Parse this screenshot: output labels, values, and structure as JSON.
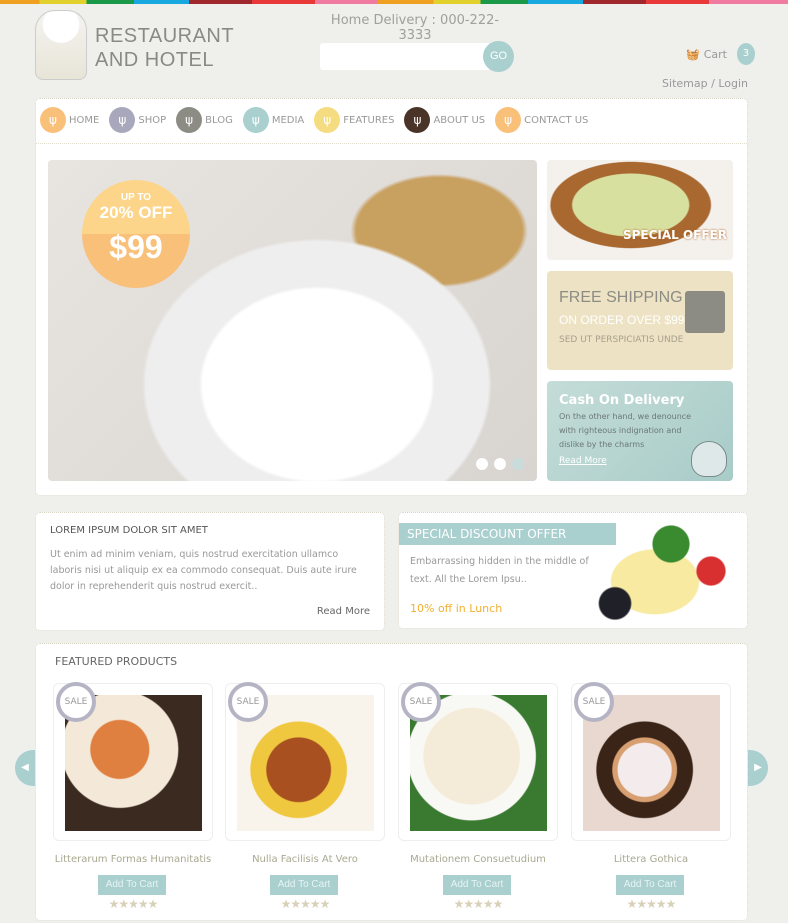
{
  "header": {
    "logo_line1": "RESTAURANT",
    "logo_line2": "AND HOTEL",
    "delivery": "Home Delivery : 000-222-3333",
    "search_placeholder": "",
    "go_label": "GO",
    "cart_label": "Cart",
    "cart_count": "3",
    "sitemap": "Sitemap",
    "login": "Login",
    "sep": " / "
  },
  "nav": [
    {
      "label": "HOME",
      "color": "#f9c07a"
    },
    {
      "label": "SHOP",
      "color": "#a8a8bc"
    },
    {
      "label": "BLOG",
      "color": "#8c8c84"
    },
    {
      "label": "MEDIA",
      "color": "#a9cfcf"
    },
    {
      "label": "FEATURES",
      "color": "#f5dc80"
    },
    {
      "label": "ABOUT US",
      "color": "#4a3428"
    },
    {
      "label": "CONTACT US",
      "color": "#f9c07a"
    }
  ],
  "slider": {
    "upto": "UP TO",
    "percent": "20% OFF",
    "price": "$99"
  },
  "side": {
    "special": "SPECIAL OFFER",
    "ship_title": "FREE SHIPPING",
    "ship_sub": "ON ORDER OVER $99",
    "ship_note": "SED UT PERSPICIATIS UNDE",
    "cod_title": "Cash On Delivery",
    "cod_text": "On the other hand, we denounce with righteous indignation and dislike by the charms",
    "cod_link": "Read More"
  },
  "lorem": {
    "title": "LOREM IPSUM DOLOR SIT AMET",
    "text": "Ut enim ad minim veniam, quis nostrud exercitation ullamco laboris nisi ut aliquip ex ea commodo consequat. Duis aute irure dolor in reprehenderit quis nostrud exercit..",
    "link": "Read More"
  },
  "discount": {
    "title": "SPECIAL DISCOUNT OFFER",
    "text": "Embarrassing hidden in the middle of text. All the Lorem Ipsu..",
    "offer": "10% off in Lunch"
  },
  "featured": {
    "title": "FEATURED PRODUCTS",
    "sale": "SALE",
    "add": "Add To Cart",
    "stars": "★★★★★",
    "rating": 0,
    "products": [
      {
        "name": "Litterarum Formas Humanitatis"
      },
      {
        "name": "Nulla Facilisis At Vero"
      },
      {
        "name": "Mutationem Consuetudium"
      },
      {
        "name": "Littera Gothica"
      }
    ]
  }
}
